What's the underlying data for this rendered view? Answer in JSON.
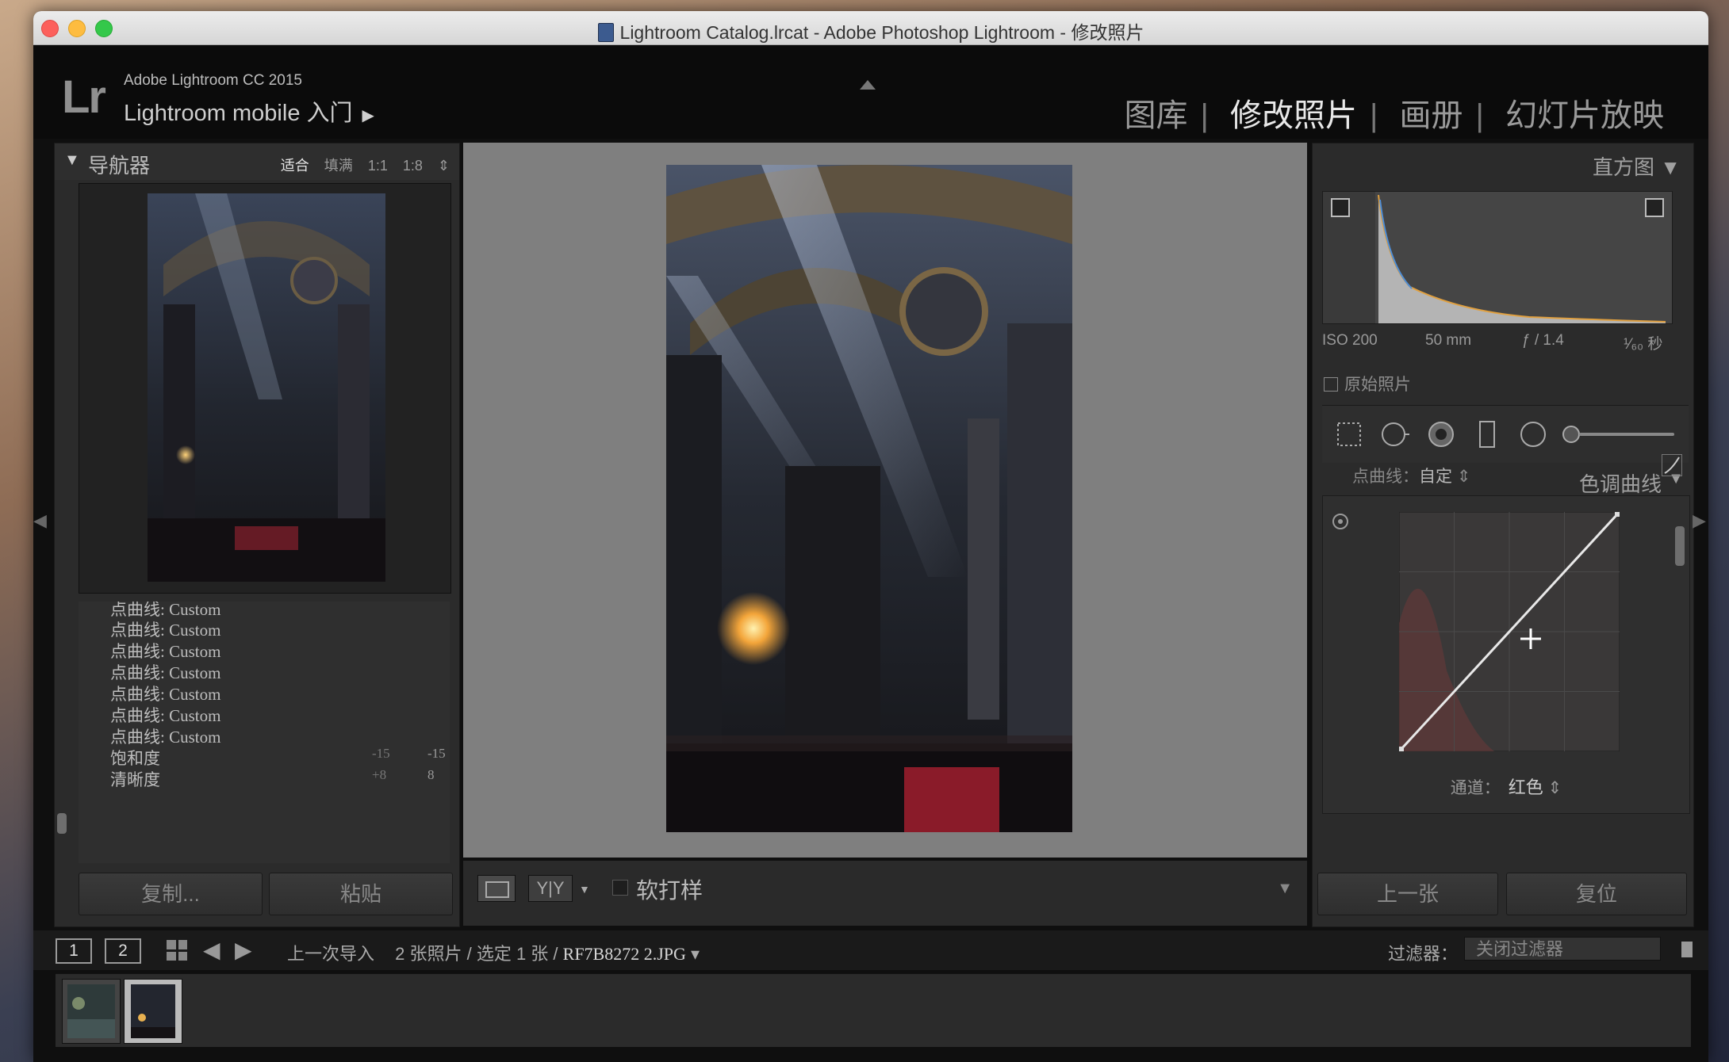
{
  "window": {
    "title": "Lightroom Catalog.lrcat - Adobe Photoshop Lightroom - 修改照片"
  },
  "header": {
    "logo": "Lr",
    "brand": "Adobe Lightroom CC 2015",
    "identity": "Lightroom mobile 入门",
    "modules": [
      "图库",
      "修改照片",
      "画册",
      "幻灯片放映"
    ],
    "active_module": "修改照片"
  },
  "navigator": {
    "title": "导航器",
    "zoom_options": [
      "适合",
      "填满",
      "1:1",
      "1:8"
    ],
    "active_zoom": "适合"
  },
  "history": {
    "items": [
      {
        "label": "点曲线: Custom",
        "a": "",
        "b": ""
      },
      {
        "label": "点曲线: Custom",
        "a": "",
        "b": ""
      },
      {
        "label": "点曲线: Custom",
        "a": "",
        "b": ""
      },
      {
        "label": "点曲线: Custom",
        "a": "",
        "b": ""
      },
      {
        "label": "点曲线: Custom",
        "a": "",
        "b": ""
      },
      {
        "label": "点曲线: Custom",
        "a": "",
        "b": ""
      },
      {
        "label": "点曲线: Custom",
        "a": "",
        "b": ""
      },
      {
        "label": "饱和度",
        "a": "-15",
        "b": "-15"
      },
      {
        "label": "清晰度",
        "a": "+8",
        "b": "8"
      }
    ]
  },
  "left_buttons": {
    "copy": "复制...",
    "paste": "粘贴"
  },
  "toolbar": {
    "yy": "Y|Y",
    "soft_proof": "软打样"
  },
  "histogram": {
    "title": "直方图",
    "iso": "ISO 200",
    "focal": "50 mm",
    "aperture": "ƒ / 1.4",
    "shutter": "¹⁄₆₀ 秒",
    "original_photo": "原始照片"
  },
  "tone_curve": {
    "title": "色调曲线",
    "channel_label": "通道：",
    "channel_value": "红色",
    "point_curve_label": "点曲线：",
    "point_curve_value": "自定"
  },
  "right_buttons": {
    "previous": "上一张",
    "reset": "复位"
  },
  "filmstrip": {
    "page1": "1",
    "page2": "2",
    "source": "上一次导入",
    "count": "2 张照片 / 选定 1 张 /",
    "filename": "RF7B8272 2.JPG",
    "filter_label": "过滤器：",
    "filter_value": "关闭过滤器"
  },
  "icons": {
    "crop": "crop-icon",
    "spot": "spot-removal-icon",
    "redeye": "redeye-icon",
    "grad": "graduated-filter-icon",
    "radial": "radial-filter-icon",
    "brush": "adjustment-brush-icon"
  }
}
